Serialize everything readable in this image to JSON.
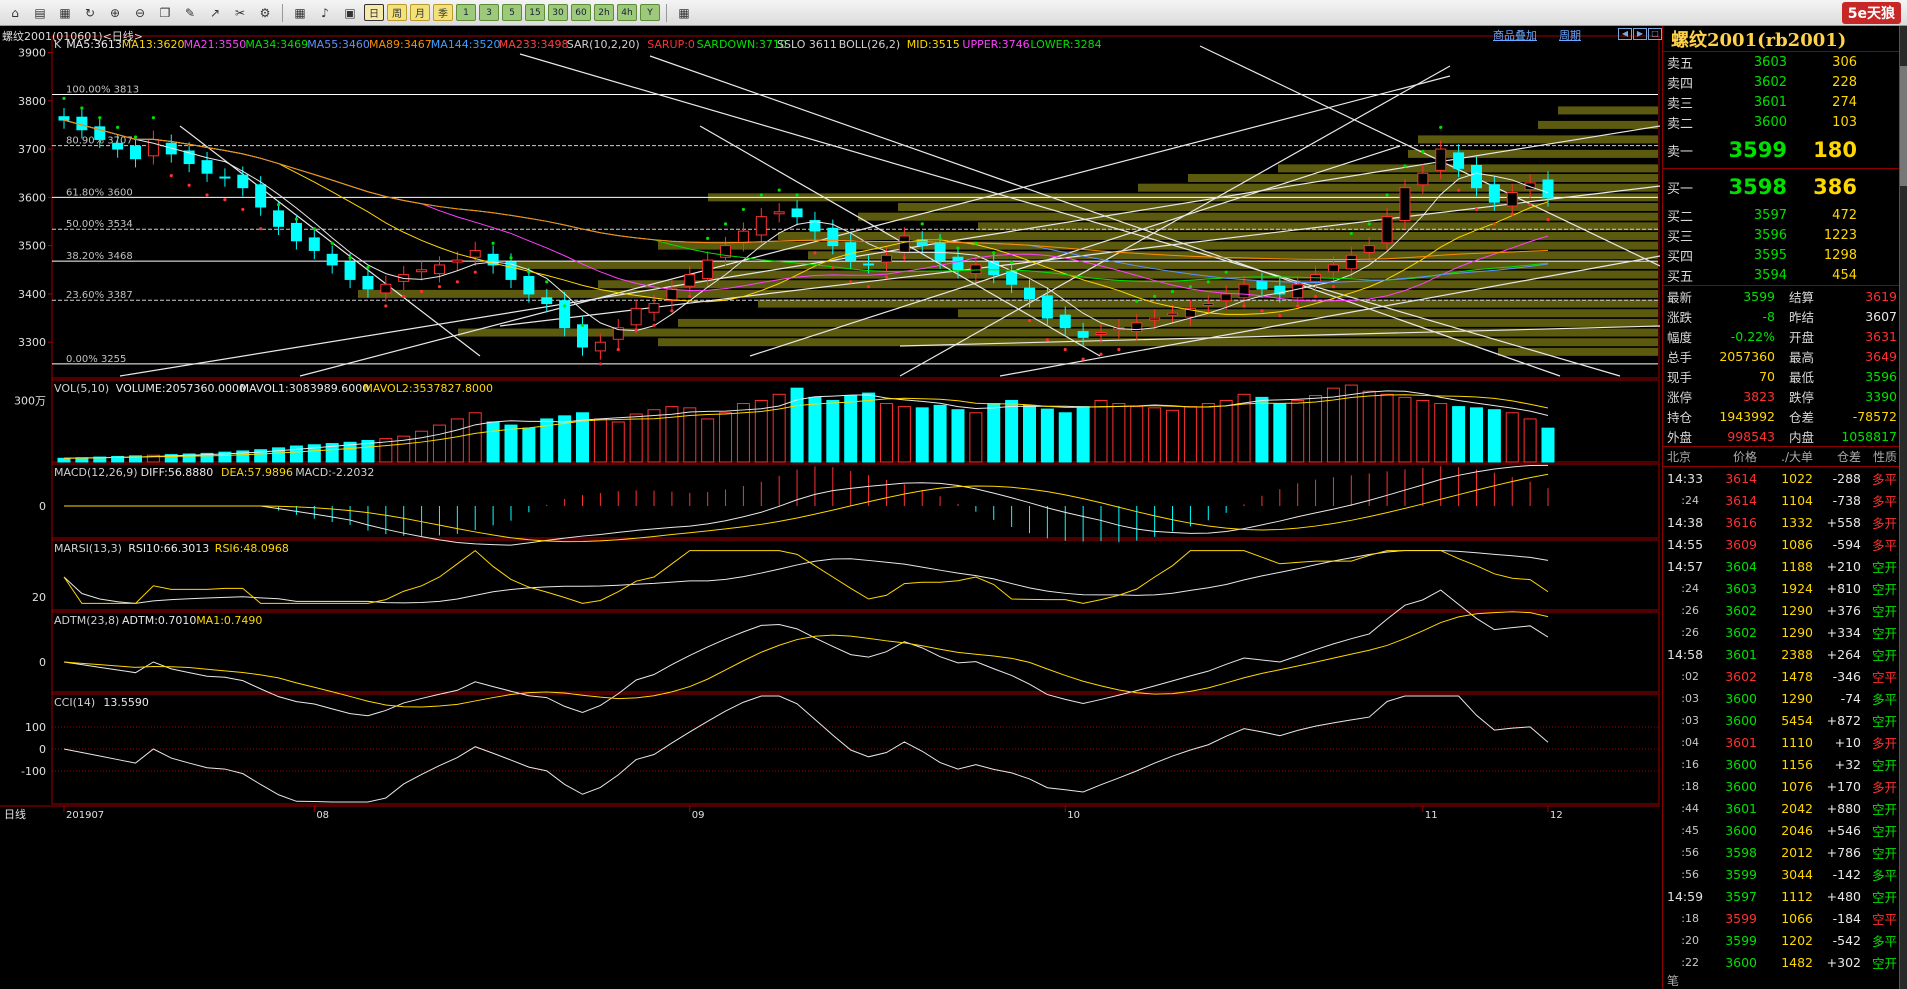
{
  "toolbar": {
    "icons": [
      "home-icon",
      "folder-icon",
      "open-icon",
      "refresh-icon",
      "zoom-in-icon",
      "zoom-out-icon",
      "window-icon",
      "pen-icon",
      "draw-icon",
      "tool-icon",
      "indicator-icon",
      "table-icon",
      "tick-icon",
      "period-icon"
    ],
    "periods": [
      "周",
      "月",
      "季",
      "1",
      "3",
      "5",
      "15",
      "30",
      "60",
      "2h",
      "4h",
      "Y"
    ],
    "active_period": "日",
    "brand": "5e天狼"
  },
  "header": {
    "symbol": "螺纹2001(010601)<日线>",
    "link1": "商品叠加",
    "link2": "周期"
  },
  "chart": {
    "main_legend": [
      {
        "t": "K",
        "c": "#d0d0d0"
      },
      {
        "t": "MA5:3613",
        "c": "#e8e8e8"
      },
      {
        "t": "MA13:3620",
        "c": "#ffd700"
      },
      {
        "t": "MA21:3550",
        "c": "#ff40ff"
      },
      {
        "t": "MA34:3469",
        "c": "#00e000"
      },
      {
        "t": "MA55:3460",
        "c": "#6090ff"
      },
      {
        "t": "MA89:3467",
        "c": "#ff8c00"
      },
      {
        "t": "MA144:3520",
        "c": "#40a0ff"
      },
      {
        "t": "MA233:3498",
        "c": "#ff4040"
      },
      {
        "t": "SAR(10,2,20)",
        "c": "#d0d0d0"
      },
      {
        "t": "SARUP:0",
        "c": "#ff3030"
      },
      {
        "t": "SARDOWN:3710",
        "c": "#00e000"
      },
      {
        "t": "SSLO 3611",
        "c": "#d0d0d0"
      },
      {
        "t": "BOLL(26,2)",
        "c": "#d0d0d0"
      },
      {
        "t": "MID:3515",
        "c": "#ffd700"
      },
      {
        "t": "UPPER:3746",
        "c": "#ff40ff"
      },
      {
        "t": "LOWER:3284",
        "c": "#00e000"
      }
    ],
    "price_ticks": [
      "3900",
      "3800",
      "3700",
      "3600",
      "3500",
      "3400",
      "3300"
    ],
    "fib_labels": [
      "100.00% 3813",
      "80.90% 3707",
      "61.80% 3600",
      "50.00% 3534",
      "38.20% 3468",
      "23.60% 3387",
      "0.00% 3255"
    ],
    "vol_legend": [
      {
        "t": "VOL(5,10)",
        "c": "#d0d0d0"
      },
      {
        "t": "VOLUME:2057360.0000",
        "c": "#e8e8e8"
      },
      {
        "t": "MAVOL1:3083989.6000",
        "c": "#e8e8e8"
      },
      {
        "t": "MAVOL2:3537827.8000",
        "c": "#ffd700"
      }
    ],
    "vol_tick": "300万",
    "macd_legend": [
      {
        "t": "MACD(12,26,9)",
        "c": "#d0d0d0"
      },
      {
        "t": "DIFF:56.8880",
        "c": "#e8e8e8"
      },
      {
        "t": "DEA:57.9896",
        "c": "#ffd700"
      },
      {
        "t": "MACD:-2.2032",
        "c": "#d0d0d0"
      }
    ],
    "macd_tick": "0",
    "rsi_legend": [
      {
        "t": "MARSI(13,3)",
        "c": "#d0d0d0"
      },
      {
        "t": "RSI10:66.3013",
        "c": "#e8e8e8"
      },
      {
        "t": "RSI6:48.0968",
        "c": "#ffd700"
      }
    ],
    "rsi_tick": "20",
    "adtm_legend": [
      {
        "t": "ADTM(23,8)",
        "c": "#d0d0d0"
      },
      {
        "t": "ADTM:0.7010",
        "c": "#e8e8e8"
      },
      {
        "t": "MA1:0.7490",
        "c": "#ffd700"
      }
    ],
    "adtm_tick": "0",
    "cci_legend": [
      {
        "t": "CCI(14)",
        "c": "#d0d0d0"
      },
      {
        "t": "13.5590",
        "c": "#e8e8e8"
      }
    ],
    "cci_ticks": [
      "100",
      "0",
      "-100"
    ],
    "date_label": "日线",
    "date_ticks": [
      "201907",
      "08",
      "09",
      "10",
      "11",
      "12"
    ]
  },
  "panel": {
    "title": "螺纹2001(rb2001)",
    "asks": [
      {
        "label": "卖五",
        "price": "3603",
        "vol": "306"
      },
      {
        "label": "卖四",
        "price": "3602",
        "vol": "228"
      },
      {
        "label": "卖三",
        "price": "3601",
        "vol": "274"
      },
      {
        "label": "卖二",
        "price": "3600",
        "vol": "103"
      },
      {
        "label": "卖一",
        "price": "3599",
        "vol": "180"
      }
    ],
    "bids": [
      {
        "label": "买一",
        "price": "3598",
        "vol": "386"
      },
      {
        "label": "买二",
        "price": "3597",
        "vol": "472"
      },
      {
        "label": "买三",
        "price": "3596",
        "vol": "1223"
      },
      {
        "label": "买四",
        "price": "3595",
        "vol": "1298"
      },
      {
        "label": "买五",
        "price": "3594",
        "vol": "454"
      }
    ],
    "quote": [
      {
        "l1": "最新",
        "v1": "3599",
        "c1": "green",
        "l2": "结算",
        "v2": "3619",
        "c2": "red"
      },
      {
        "l1": "涨跌",
        "v1": "-8",
        "c1": "green",
        "l2": "昨结",
        "v2": "3607",
        "c2": "white"
      },
      {
        "l1": "幅度",
        "v1": "-0.22%",
        "c1": "green",
        "l2": "开盘",
        "v2": "3631",
        "c2": "red"
      },
      {
        "l1": "总手",
        "v1": "2057360",
        "c1": "yellow",
        "l2": "最高",
        "v2": "3649",
        "c2": "red"
      },
      {
        "l1": "现手",
        "v1": "70",
        "c1": "yellow",
        "l2": "最低",
        "v2": "3596",
        "c2": "green"
      },
      {
        "l1": "涨停",
        "v1": "3823",
        "c1": "red",
        "l2": "跌停",
        "v2": "3390",
        "c2": "green"
      },
      {
        "l1": "持仓",
        "v1": "1943992",
        "c1": "yellow",
        "l2": "仓差",
        "v2": "-78572",
        "c2": "yellow"
      },
      {
        "l1": "外盘",
        "v1": "998543",
        "c1": "red",
        "l2": "内盘",
        "v2": "1058817",
        "c2": "green"
      }
    ],
    "ticks_header": {
      "time": "北京",
      "price": "价格",
      "vol": "./大单",
      "oi": "仓差",
      "nature": "性质"
    },
    "ticks": [
      {
        "t": "14:33",
        "full": true,
        "p": "3614",
        "pc": "red",
        "v": "1022",
        "oi": "-288",
        "n": "多平",
        "nc": "red"
      },
      {
        "t": ":24",
        "full": false,
        "p": "3614",
        "pc": "red",
        "v": "1104",
        "oi": "-738",
        "n": "多平",
        "nc": "red"
      },
      {
        "t": "14:38",
        "full": true,
        "p": "3616",
        "pc": "red",
        "v": "1332",
        "oi": "+558",
        "n": "多开",
        "nc": "red"
      },
      {
        "t": "14:55",
        "full": true,
        "p": "3609",
        "pc": "red",
        "v": "1086",
        "oi": "-594",
        "n": "多平",
        "nc": "red"
      },
      {
        "t": "14:57",
        "full": true,
        "p": "3604",
        "pc": "green",
        "v": "1188",
        "oi": "+210",
        "n": "空开",
        "nc": "green"
      },
      {
        "t": ":24",
        "full": false,
        "p": "3603",
        "pc": "green",
        "v": "1924",
        "oi": "+810",
        "n": "空开",
        "nc": "green"
      },
      {
        "t": ":26",
        "full": false,
        "p": "3602",
        "pc": "green",
        "v": "1290",
        "oi": "+376",
        "n": "空开",
        "nc": "green"
      },
      {
        "t": ":26",
        "full": false,
        "p": "3602",
        "pc": "green",
        "v": "1290",
        "oi": "+334",
        "n": "空开",
        "nc": "green"
      },
      {
        "t": "14:58",
        "full": true,
        "p": "3601",
        "pc": "green",
        "v": "2388",
        "oi": "+264",
        "n": "空开",
        "nc": "green"
      },
      {
        "t": ":02",
        "full": false,
        "p": "3602",
        "pc": "red",
        "v": "1478",
        "oi": "-346",
        "n": "空平",
        "nc": "red"
      },
      {
        "t": ":03",
        "full": false,
        "p": "3600",
        "pc": "green",
        "v": "1290",
        "oi": "-74",
        "n": "多平",
        "nc": "green"
      },
      {
        "t": ":03",
        "full": false,
        "p": "3600",
        "pc": "green",
        "v": "5454",
        "oi": "+872",
        "n": "空开",
        "nc": "green"
      },
      {
        "t": ":04",
        "full": false,
        "p": "3601",
        "pc": "red",
        "v": "1110",
        "oi": "+10",
        "n": "多开",
        "nc": "red"
      },
      {
        "t": ":16",
        "full": false,
        "p": "3600",
        "pc": "green",
        "v": "1156",
        "oi": "+32",
        "n": "空开",
        "nc": "green"
      },
      {
        "t": ":18",
        "full": false,
        "p": "3600",
        "pc": "green",
        "v": "1076",
        "oi": "+170",
        "n": "多开",
        "nc": "red"
      },
      {
        "t": ":44",
        "full": false,
        "p": "3601",
        "pc": "green",
        "v": "2042",
        "oi": "+880",
        "n": "空开",
        "nc": "green"
      },
      {
        "t": ":45",
        "full": false,
        "p": "3600",
        "pc": "green",
        "v": "2046",
        "oi": "+546",
        "n": "空开",
        "nc": "green"
      },
      {
        "t": ":56",
        "full": false,
        "p": "3598",
        "pc": "green",
        "v": "2012",
        "oi": "+786",
        "n": "空开",
        "nc": "green"
      },
      {
        "t": ":56",
        "full": false,
        "p": "3599",
        "pc": "green",
        "v": "3044",
        "oi": "-142",
        "n": "多平",
        "nc": "green"
      },
      {
        "t": "14:59",
        "full": true,
        "p": "3597",
        "pc": "green",
        "v": "1112",
        "oi": "+480",
        "n": "空开",
        "nc": "green"
      },
      {
        "t": ":18",
        "full": false,
        "p": "3599",
        "pc": "red",
        "v": "1066",
        "oi": "-184",
        "n": "空平",
        "nc": "red"
      },
      {
        "t": ":20",
        "full": false,
        "p": "3599",
        "pc": "green",
        "v": "1202",
        "oi": "-542",
        "n": "多平",
        "nc": "green"
      },
      {
        "t": ":22",
        "full": false,
        "p": "3600",
        "pc": "green",
        "v": "1482",
        "oi": "+302",
        "n": "空开",
        "nc": "green"
      }
    ],
    "footer": "笔"
  },
  "chart_data": {
    "type": "candlestick",
    "x": [
      "2019-07",
      "2019-08",
      "2019-09",
      "2019-10",
      "2019-11",
      "2019-12"
    ],
    "close": [
      3760,
      3740,
      3720,
      3700,
      3680,
      3720,
      3690,
      3670,
      3650,
      3640,
      3620,
      3580,
      3540,
      3510,
      3490,
      3460,
      3430,
      3410,
      3420,
      3440,
      3450,
      3460,
      3470,
      3490,
      3460,
      3430,
      3400,
      3380,
      3330,
      3290,
      3300,
      3330,
      3370,
      3380,
      3410,
      3440,
      3470,
      3500,
      3530,
      3560,
      3570,
      3560,
      3530,
      3500,
      3470,
      3460,
      3480,
      3520,
      3500,
      3470,
      3450,
      3460,
      3440,
      3420,
      3390,
      3350,
      3330,
      3310,
      3320,
      3330,
      3340,
      3350,
      3360,
      3370,
      3380,
      3400,
      3420,
      3410,
      3400,
      3420,
      3440,
      3460,
      3480,
      3500,
      3560,
      3620,
      3650,
      3700,
      3660,
      3620,
      3590,
      3610,
      3630,
      3599
    ],
    "volume": [
      6,
      7,
      8,
      9,
      10,
      11,
      12,
      13,
      14,
      16,
      18,
      20,
      23,
      26,
      28,
      30,
      32,
      35,
      38,
      42,
      50,
      60,
      70,
      80,
      65,
      60,
      55,
      70,
      75,
      80,
      70,
      65,
      78,
      85,
      90,
      88,
      70,
      80,
      95,
      100,
      110,
      120,
      105,
      100,
      108,
      112,
      95,
      90,
      88,
      92,
      85,
      80,
      95,
      100,
      92,
      86,
      80,
      90,
      100,
      95,
      90,
      88,
      84,
      90,
      95,
      100,
      110,
      105,
      95,
      100,
      108,
      120,
      125,
      115,
      110,
      105,
      100,
      95,
      90,
      88,
      85,
      80,
      70,
      55
    ]
  }
}
